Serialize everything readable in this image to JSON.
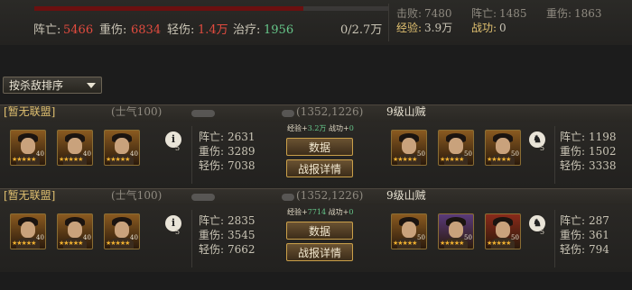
{
  "summary": {
    "progress_fill_fraction": 0.76,
    "dead_label": "阵亡:",
    "dead_value": "5466",
    "heavy_label": "重伤:",
    "heavy_value": "6834",
    "light_label": "轻伤:",
    "light_value": "1.4万",
    "heal_label": "治疗:",
    "heal_value": "1956",
    "capacity": "0/2.7万",
    "kills_label": "击败:",
    "kills_value": "7480",
    "exp_label": "经验:",
    "exp_value": "3.9万",
    "enemy_dead_label": "阵亡:",
    "enemy_dead_value": "1485",
    "merit_label": "战功:",
    "merit_value": "0",
    "enemy_heavy_label": "重伤:",
    "enemy_heavy_value": "1863"
  },
  "sort": {
    "label": "按杀敌排序"
  },
  "battles": [
    {
      "alliance": "[暂无联盟]",
      "morale": "(士气100)",
      "coords": "(1352,1226)",
      "enemy_name": "9级山贼",
      "own_heroes": [
        {
          "color": "#8a5a20",
          "stars": "★★★★★",
          "level": "40"
        },
        {
          "color": "#8a5a20",
          "stars": "★★★★★",
          "level": "40"
        },
        {
          "color": "#8a5a20",
          "stars": "★★★★★",
          "level": "40"
        }
      ],
      "own_role": "5",
      "own_dead_label": "阵亡:",
      "own_dead": "2631",
      "own_heavy_label": "重伤:",
      "own_heavy": "3289",
      "own_light_label": "轻伤:",
      "own_light": "7038",
      "reward_exp_label": "经验+",
      "reward_exp": "3.2万",
      "reward_merit_label": "战功+",
      "reward_merit": "0",
      "btn_data": "数据",
      "btn_report": "战报详情",
      "enemy_heroes": [
        {
          "color": "#8a5a20",
          "stars": "★★★★★",
          "level": "50"
        },
        {
          "color": "#8a5a20",
          "stars": "★★★★★",
          "level": "50"
        },
        {
          "color": "#8a5a20",
          "stars": "★★★★★",
          "level": "50"
        }
      ],
      "enemy_role": "5",
      "enemy_dead_label": "阵亡:",
      "enemy_dead": "1198",
      "enemy_heavy_label": "重伤:",
      "enemy_heavy": "1502",
      "enemy_light_label": "轻伤:",
      "enemy_light": "3338"
    },
    {
      "alliance": "[暂无联盟]",
      "morale": "(士气100)",
      "coords": "(1352,1226)",
      "enemy_name": "9级山贼",
      "own_heroes": [
        {
          "color": "#8a5a20",
          "stars": "★★★★★",
          "level": "40"
        },
        {
          "color": "#8a5a20",
          "stars": "★★★★★",
          "level": "40"
        },
        {
          "color": "#8a5a20",
          "stars": "★★★★★",
          "level": "40"
        }
      ],
      "own_role": "5",
      "own_dead_label": "阵亡:",
      "own_dead": "2835",
      "own_heavy_label": "重伤:",
      "own_heavy": "3545",
      "own_light_label": "轻伤:",
      "own_light": "7662",
      "reward_exp_label": "经验+",
      "reward_exp": "7714",
      "reward_merit_label": "战功+",
      "reward_merit": "0",
      "btn_data": "数据",
      "btn_report": "战报详情",
      "enemy_heroes": [
        {
          "color": "#8a5a20",
          "stars": "★★★★★",
          "level": "50"
        },
        {
          "color": "#5a3a7a",
          "stars": "★★★★★",
          "level": "50"
        },
        {
          "color": "#8a2a1a",
          "stars": "★★★★★",
          "level": "50"
        }
      ],
      "enemy_role": "5",
      "enemy_dead_label": "阵亡:",
      "enemy_dead": "287",
      "enemy_heavy_label": "重伤:",
      "enemy_heavy": "361",
      "enemy_light_label": "轻伤:",
      "enemy_light": "794"
    }
  ],
  "icons": {
    "own_role_icon": "soldier-icon",
    "enemy_role_icon": "horse-icon"
  }
}
